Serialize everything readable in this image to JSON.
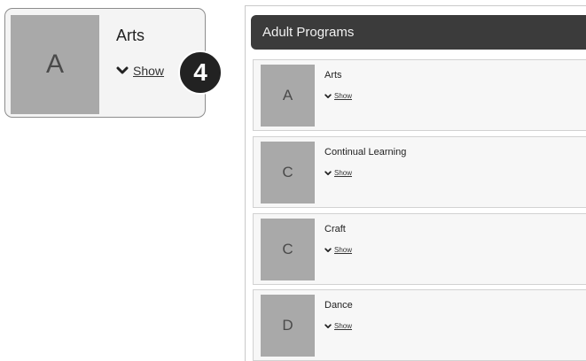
{
  "callout": {
    "tile_letter": "A",
    "title": "Arts",
    "show_label": "Show",
    "step_number": "4"
  },
  "panel": {
    "title": "Adult Programs",
    "programs": [
      {
        "letter": "A",
        "name": "Arts",
        "show_label": "Show"
      },
      {
        "letter": "C",
        "name": "Continual Learning",
        "show_label": "Show"
      },
      {
        "letter": "C",
        "name": "Craft",
        "show_label": "Show"
      },
      {
        "letter": "D",
        "name": "Dance",
        "show_label": "Show"
      }
    ]
  },
  "colors": {
    "header_bg": "#3b3b3b",
    "tile_bg": "#a9a9a9",
    "badge_bg": "#222222"
  }
}
